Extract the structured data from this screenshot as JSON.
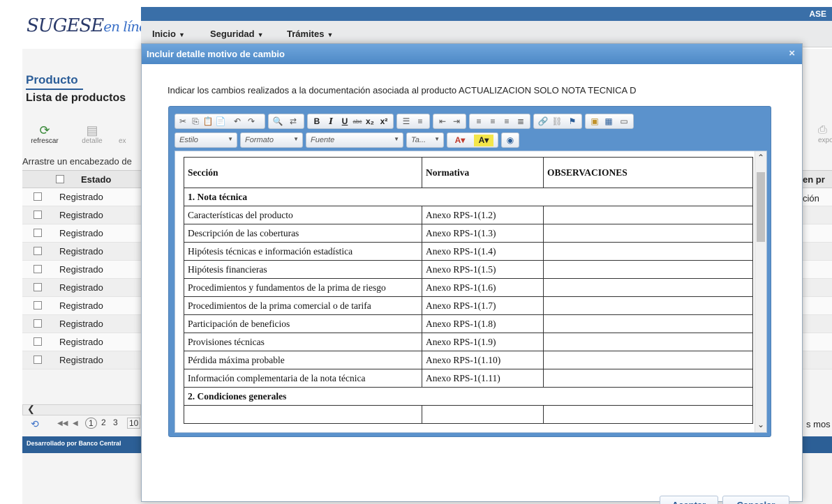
{
  "app": {
    "logo_text": "SUGESE",
    "logo_accent": "en línea",
    "user_badge": "ASE",
    "menu": [
      {
        "label": "Inicio"
      },
      {
        "label": "Seguridad"
      },
      {
        "label": "Trámites"
      }
    ]
  },
  "page": {
    "title": "Producto",
    "subtitle": "Lista de productos",
    "toolbar": {
      "refresh_label": "refrescar",
      "detail_label": "detalle",
      "export_partial": "ex",
      "export_right": "export"
    },
    "group_hint": "Arrastre un encabezado de",
    "grid": {
      "header_estado": "Estado",
      "header_right": "en pr",
      "right_row_text": "ción",
      "rows": [
        "Registrado",
        "Registrado",
        "Registrado",
        "Registrado",
        "Registrado",
        "Registrado",
        "Registrado",
        "Registrado",
        "Registrado",
        "Registrado"
      ]
    },
    "pager": {
      "first": "◀◀",
      "prev": "◀",
      "pages": [
        "1",
        "2",
        "3",
        "10"
      ],
      "right_text": "s mos"
    },
    "footer": "Desarrollado por Banco Central"
  },
  "modal": {
    "title": "Incluir detalle motivo de cambio",
    "close_glyph": "×",
    "instruction": "Indicar los cambios realizados a la documentación asociada al producto ACTUALIZACION SOLO NOTA TECNICA D",
    "editor": {
      "combos": [
        "Estilo",
        "Formato",
        "Fuente",
        "Ta..."
      ],
      "table": {
        "headers": [
          "Sección",
          "Normativa",
          "OBSERVACIONES"
        ],
        "group1": "1. Nota técnica",
        "rows": [
          {
            "seccion": "Características del producto",
            "normativa": "Anexo RPS-1(1.2)",
            "obs": ""
          },
          {
            "seccion": "Descripción de las coberturas",
            "normativa": "Anexo RPS-1(1.3)",
            "obs": ""
          },
          {
            "seccion": "Hipótesis técnicas e información estadística",
            "normativa": "Anexo RPS-1(1.4)",
            "obs": ""
          },
          {
            "seccion": "Hipótesis financieras",
            "normativa": "Anexo RPS-1(1.5)",
            "obs": ""
          },
          {
            "seccion": "Procedimientos y fundamentos de la prima de riesgo",
            "normativa": "Anexo RPS-1(1.6)",
            "obs": ""
          },
          {
            "seccion": "Procedimientos de la prima comercial o de tarifa",
            "normativa": "Anexo RPS-1(1.7)",
            "obs": ""
          },
          {
            "seccion": "Participación de beneficios",
            "normativa": "Anexo RPS-1(1.8)",
            "obs": ""
          },
          {
            "seccion": "Provisiones técnicas",
            "normativa": "Anexo RPS-1(1.9)",
            "obs": ""
          },
          {
            "seccion": "Pérdida máxima probable",
            "normativa": "Anexo RPS-1(1.10)",
            "obs": ""
          },
          {
            "seccion": "Información complementaria de la nota técnica",
            "normativa": "Anexo RPS-1(1.11)",
            "obs": ""
          }
        ],
        "group2": "2. Condiciones generales"
      }
    },
    "accept_label": "Aceptar",
    "cancel_label": "Cancelar"
  }
}
